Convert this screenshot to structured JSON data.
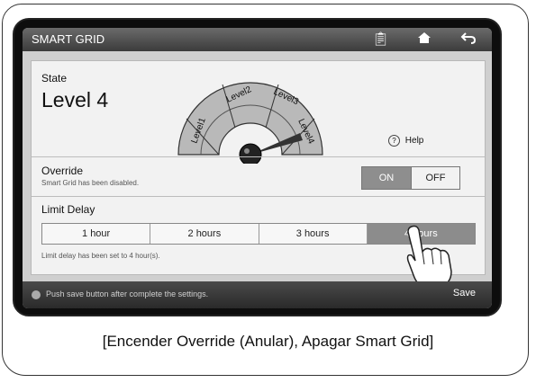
{
  "window": {
    "title": "SMART GRID"
  },
  "toolbar": {
    "clipboard_icon": "clipboard-icon",
    "home_icon": "home-icon",
    "back_icon": "back-icon"
  },
  "state": {
    "label": "State",
    "value": "Level 4"
  },
  "gauge": {
    "levels": [
      "Level1",
      "Level2",
      "Level3",
      "Level4"
    ],
    "current_level": 4
  },
  "help": {
    "icon": "?",
    "label": "Help"
  },
  "override": {
    "title": "Override",
    "description": "Smart Grid has been disabled.",
    "on_label": "ON",
    "off_label": "OFF",
    "selected": "ON"
  },
  "limit_delay": {
    "title": "Limit Delay",
    "options": [
      "1 hour",
      "2 hours",
      "3 hours",
      "4 hours"
    ],
    "selected_index": 3,
    "description": "Limit delay has been set to 4 hour(s)."
  },
  "bottom": {
    "hint": "Push save button after complete the settings.",
    "save_label": "Save"
  },
  "caption": "[Encender Override (Anular), Apagar Smart Grid]",
  "colors": {
    "gauge_fill": "#b9b9b9",
    "selected_segment": "#8c8c8c",
    "titlebar": "#4a4a4a"
  }
}
